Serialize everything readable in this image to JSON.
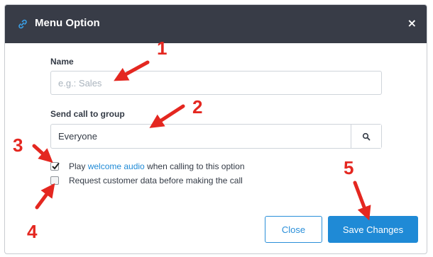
{
  "modal": {
    "title": "Menu Option",
    "close_glyph": "×",
    "title_icon": "link-icon"
  },
  "form": {
    "name_label": "Name",
    "name_placeholder": "e.g.: Sales",
    "group_label": "Send call to group",
    "group_value": "Everyone",
    "group_search_icon": "search-icon",
    "options": [
      {
        "checked": true,
        "text_before": "Play ",
        "link": "welcome audio",
        "text_after": " when calling to this option"
      },
      {
        "checked": false,
        "text": "Request customer data before making the call"
      }
    ]
  },
  "buttons": {
    "close_label": "Close",
    "save_label": "Save Changes"
  },
  "annotations": [
    "1",
    "2",
    "3",
    "4",
    "5"
  ],
  "colors": {
    "header_bg": "#383c47",
    "accent": "#1f8ad6",
    "annotation": "#e42720"
  }
}
